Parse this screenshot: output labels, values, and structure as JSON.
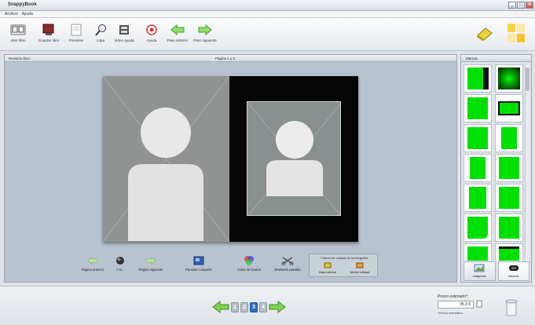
{
  "window": {
    "title": "SnappyBook",
    "controls": [
      "_",
      "□",
      "X"
    ]
  },
  "menu": [
    "Archivo",
    "Ayuda"
  ],
  "toolbar": [
    {
      "label": "Abrir libro",
      "icon": "open-book-icon"
    },
    {
      "label": "Guardar libro",
      "icon": "save-book-icon"
    },
    {
      "label": "Previstas",
      "icon": "preview-icon"
    },
    {
      "label": "Lupa",
      "icon": "magnifier-icon"
    },
    {
      "label": "Video ayuda",
      "icon": "video-help-icon"
    },
    {
      "label": "Ayuda",
      "icon": "help-icon"
    },
    {
      "label": "Paso anterior",
      "icon": "step-back-icon"
    },
    {
      "label": "Paso siguiente",
      "icon": "step-forward-icon"
    }
  ],
  "left_panel": {
    "title": "Revisión libro",
    "page_indicator": "Página 1 y 2"
  },
  "bottom_tools": [
    {
      "label": "Página anterior",
      "icon": "previous-page-icon"
    },
    {
      "label": "Y si...",
      "icon": "globe-icon"
    },
    {
      "label": "Página siguiente",
      "icon": "next-page-icon"
    },
    {
      "label": "Paneles compartir",
      "icon": "share-panels-icon"
    },
    {
      "label": "Color de fondos",
      "icon": "background-color-icon"
    },
    {
      "label": "Rediseño plantilla",
      "icon": "template-redesign-icon"
    }
  ],
  "quality_box": {
    "title": "Criterio de calidad de la fotografía",
    "items": [
      {
        "label": "Baja calidad",
        "icon": "low-quality-icon"
      },
      {
        "label": "Media calidad",
        "icon": "medium-quality-icon"
      }
    ]
  },
  "right_panel": {
    "title": "Marcos",
    "tabs": [
      {
        "label": "Imágenes",
        "icon": "images-icon"
      },
      {
        "label": "Marcos",
        "icon": "frames-icon"
      }
    ]
  },
  "footer": {
    "pages": [
      "1",
      "2",
      "3",
      "4"
    ],
    "active_page": "3",
    "price_label": "Precio estimado*:",
    "price_value": "35,3 €",
    "price_note": "*Precio orientativo"
  },
  "colors": {
    "accent_green": "#00e000",
    "active_page": "#2f6fc4",
    "workspace": "#b7c3cf"
  }
}
